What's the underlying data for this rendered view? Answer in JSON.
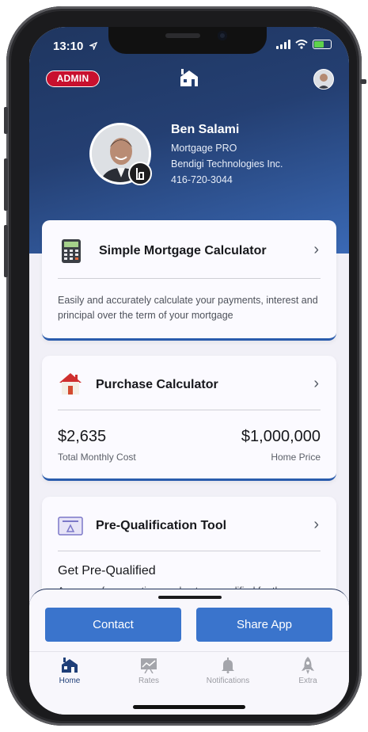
{
  "status_bar": {
    "time": "13:10"
  },
  "header": {
    "admin_badge": "ADMIN"
  },
  "profile": {
    "name": "Ben Salami",
    "title": "Mortgage PRO",
    "company": "Bendigi Technologies Inc.",
    "phone": "416-720-3044"
  },
  "cards": {
    "simple": {
      "title": "Simple Mortgage Calculator",
      "description": "Easily and accurately calculate your payments, interest and principal over the term of your mortgage"
    },
    "purchase": {
      "title": "Purchase Calculator",
      "monthly_cost": "$2,635",
      "monthly_cost_label": "Total Monthly Cost",
      "home_price": "$1,000,000",
      "home_price_label": "Home Price"
    },
    "prequal": {
      "title": "Pre-Qualification Tool",
      "subtitle": "Get Pre-Qualified",
      "description": "Answer a few questions and get pre-qualified for the"
    }
  },
  "actions": {
    "contact": "Contact",
    "share": "Share App"
  },
  "tabs": [
    {
      "label": "Home",
      "icon": "home-icon"
    },
    {
      "label": "Rates",
      "icon": "rates-chart-icon"
    },
    {
      "label": "Notifications",
      "icon": "bell-icon"
    },
    {
      "label": "Extra",
      "icon": "rocket-icon"
    }
  ],
  "colors": {
    "brand_dark": "#1f3660",
    "brand_blue": "#3a74cc",
    "admin_red": "#c8102e",
    "card_border": "#2a5cad"
  }
}
